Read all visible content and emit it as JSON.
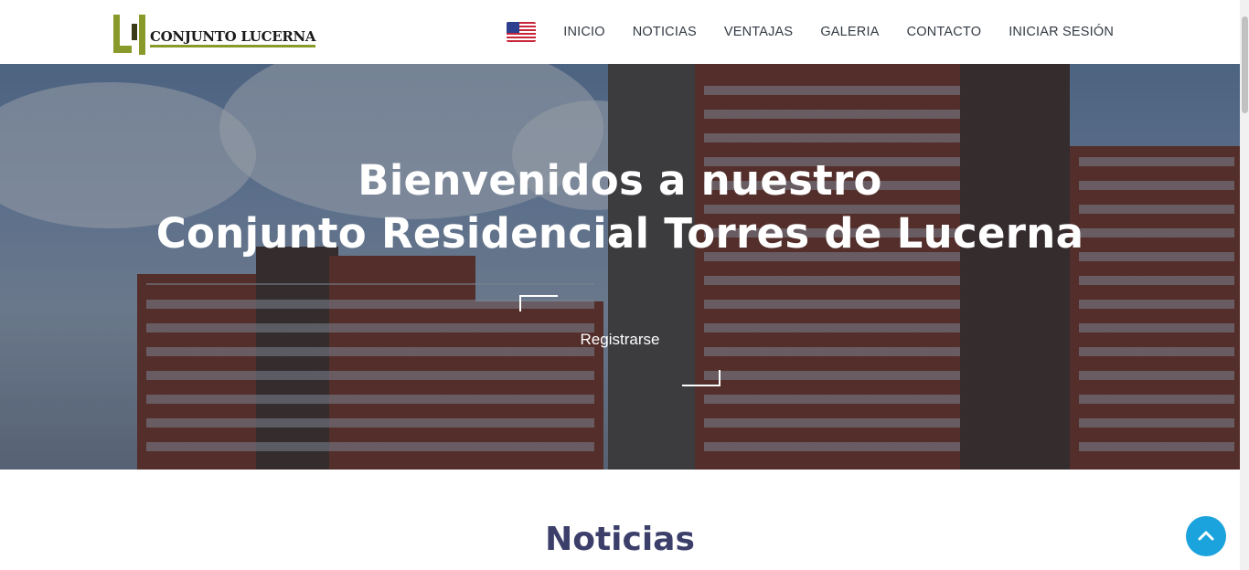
{
  "brand": {
    "name": "CONJUNTO LUCERNA",
    "accent_color": "#8a9a2a"
  },
  "nav": {
    "language_icon": "us-flag-icon",
    "items": [
      "INICIO",
      "NOTICIAS",
      "VENTAJAS",
      "GALERIA",
      "CONTACTO",
      "INICIAR SESIÓN"
    ]
  },
  "hero": {
    "title_line1": "Bienvenidos a nuestro",
    "title_line2": "Conjunto Residencial Torres de Lucerna",
    "cta_label": "Registrarse"
  },
  "section": {
    "title": "Noticias",
    "title_color": "#3c3f6a"
  },
  "back_to_top": {
    "icon": "chevron-up-icon",
    "color": "#1aa3dc"
  }
}
